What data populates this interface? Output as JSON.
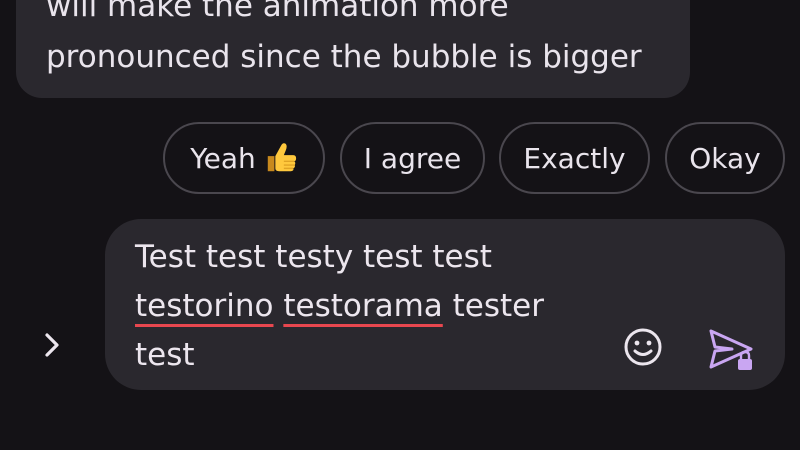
{
  "message": {
    "line1": "will make the animation more",
    "line2": "pronounced since the bubble is bigger"
  },
  "smart_replies": [
    {
      "label": "Yeah",
      "emoji_icon": "thumbs-up-icon"
    },
    {
      "label": "I agree"
    },
    {
      "label": "Exactly"
    },
    {
      "label": "Okay"
    }
  ],
  "compose": {
    "line1": "Test test testy test test",
    "line2_word1": "testorino",
    "line2_word2": "testorama",
    "line2_rest": "tester",
    "line3": "test"
  },
  "icons": {
    "expand": "chevron-right-icon",
    "emoji": "emoji-smile-icon",
    "send": "send-locked-icon"
  },
  "colors": {
    "background": "#141216",
    "bubble": "#2a282e",
    "send_accent": "#c9a6f2",
    "spellcheck": "#e8474f"
  }
}
